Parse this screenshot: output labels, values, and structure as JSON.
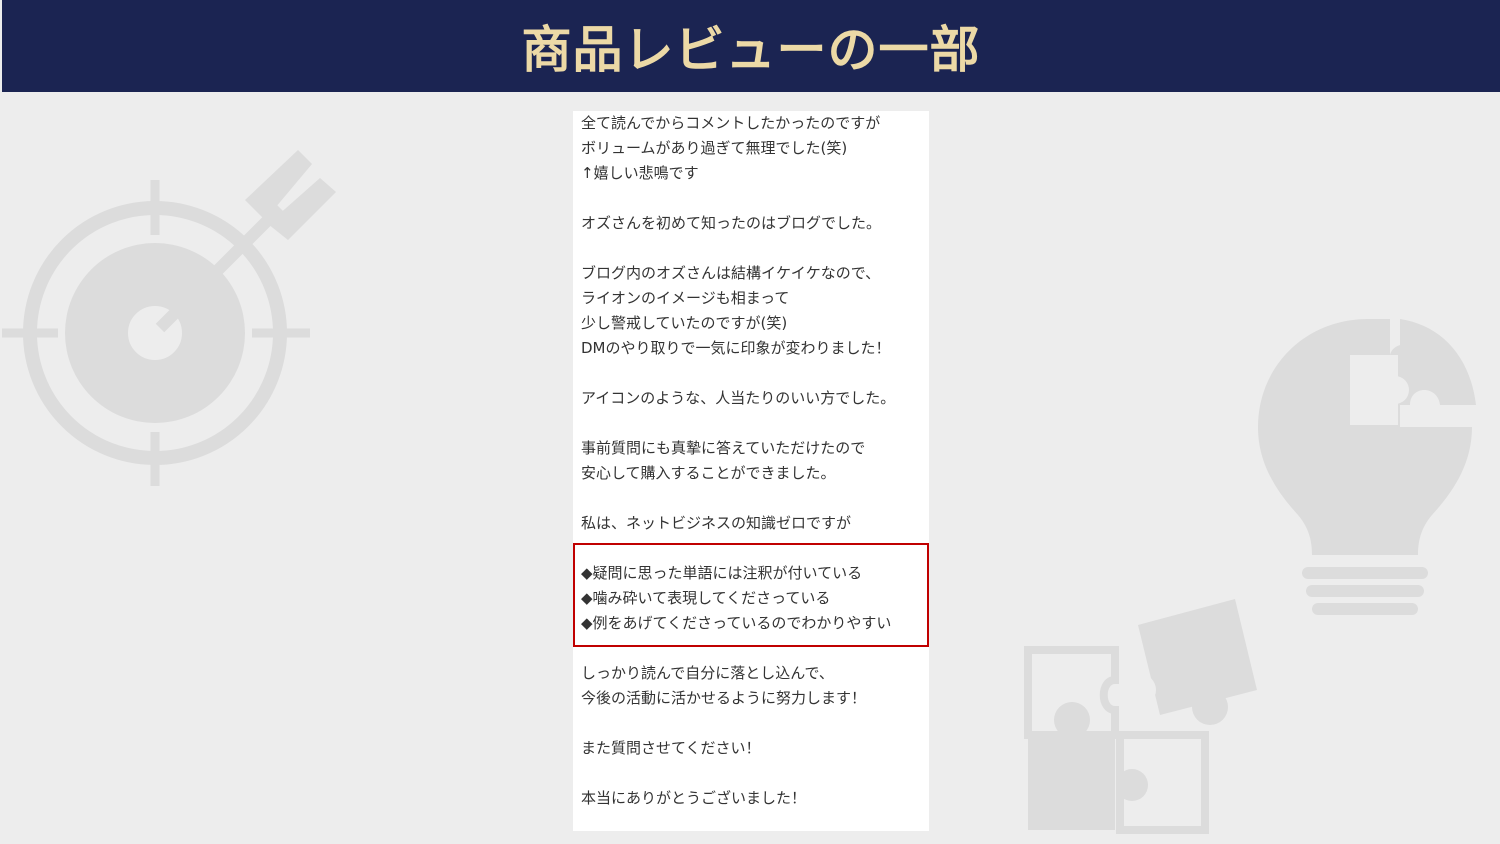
{
  "header": {
    "title": "商品レビューの一部"
  },
  "colors": {
    "header_bg": "#1b2452",
    "title_text": "#ecd9a6",
    "page_bg": "#ededed",
    "decor_gray": "#dcdcdc",
    "highlight_border": "#c00000"
  },
  "decorations": {
    "left_icon": "target-arrow-icon",
    "right_icons": [
      "lightbulb-puzzle-icon",
      "puzzle-pieces-icon"
    ]
  },
  "review": {
    "lines": [
      "全て読んでからコメントしたかったのですが",
      "ボリュームがあり過ぎて無理でした(笑)",
      "↑嬉しい悲鳴です",
      "オズさんを初めて知ったのはブログでした。",
      "ブログ内のオズさんは結構イケイケなので、",
      "ライオンのイメージも相まって",
      "少し警戒していたのですが(笑)",
      "DMのやり取りで一気に印象が変わりました！",
      "アイコンのような、人当たりのいい方でした。",
      "事前質問にも真摯に答えていただけたので",
      "安心して購入することができました。",
      "私は、ネットビジネスの知識ゼロですが",
      "◆疑問に思った単語には注釈が付いている",
      "◆噛み砕いて表現してくださっている",
      "◆例をあげてくださっているのでわかりやすい",
      "しっかり読んで自分に落とし込んで、",
      "今後の活動に活かせるように努力します！",
      "また質問させてください！",
      "本当にありがとうございました！"
    ]
  }
}
